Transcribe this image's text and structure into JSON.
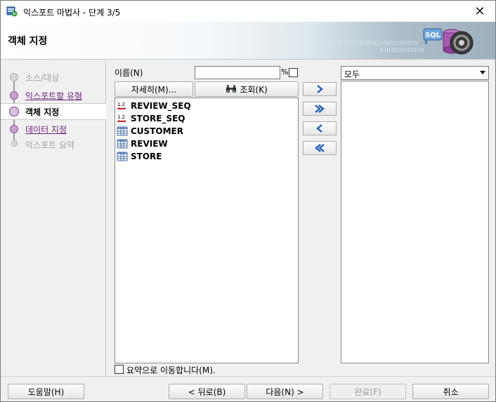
{
  "window": {
    "title": "익스포트 마법사 - 단계 3/5",
    "close_glyph": "✕"
  },
  "header": {
    "title": "객체 지정",
    "binary_line1": "0010101010101010101010101010",
    "binary_line2": "0101010101010"
  },
  "nav": {
    "items": [
      {
        "label": "소스/대상",
        "state": "disabled"
      },
      {
        "label": "익스포트할 유형",
        "state": "link"
      },
      {
        "label": "객체 지정",
        "state": "current"
      },
      {
        "label": "데이터 지정",
        "state": "link"
      },
      {
        "label": "익스포트 요약",
        "state": "disabled"
      }
    ]
  },
  "form": {
    "name_label": "이름(N)",
    "name_value": "",
    "percent_symbol": "%",
    "details_button": "자세히(M)...",
    "query_button": "조회(K)"
  },
  "available_objects": [
    {
      "name": "REVIEW_SEQ",
      "type": "sequence"
    },
    {
      "name": "STORE_SEQ",
      "type": "sequence"
    },
    {
      "name": "CUSTOMER",
      "type": "table"
    },
    {
      "name": "REVIEW",
      "type": "table"
    },
    {
      "name": "STORE",
      "type": "table"
    }
  ],
  "move_buttons": {
    "move_right": "›",
    "move_all_right": "»",
    "move_left": "‹",
    "move_all_left": "«"
  },
  "selected": {
    "filter_value": "모두",
    "items": []
  },
  "summary_checkbox": {
    "label": "요약으로 이동합니다(M).",
    "checked": false
  },
  "footer": {
    "help": "도움말(H)",
    "back": "< 뒤로(B)",
    "next": "다음(N) >",
    "finish": "완료(F)",
    "cancel": "취소"
  },
  "colors": {
    "accent_purple": "#6b1f7a",
    "disabled_text": "#a0a0a0"
  }
}
